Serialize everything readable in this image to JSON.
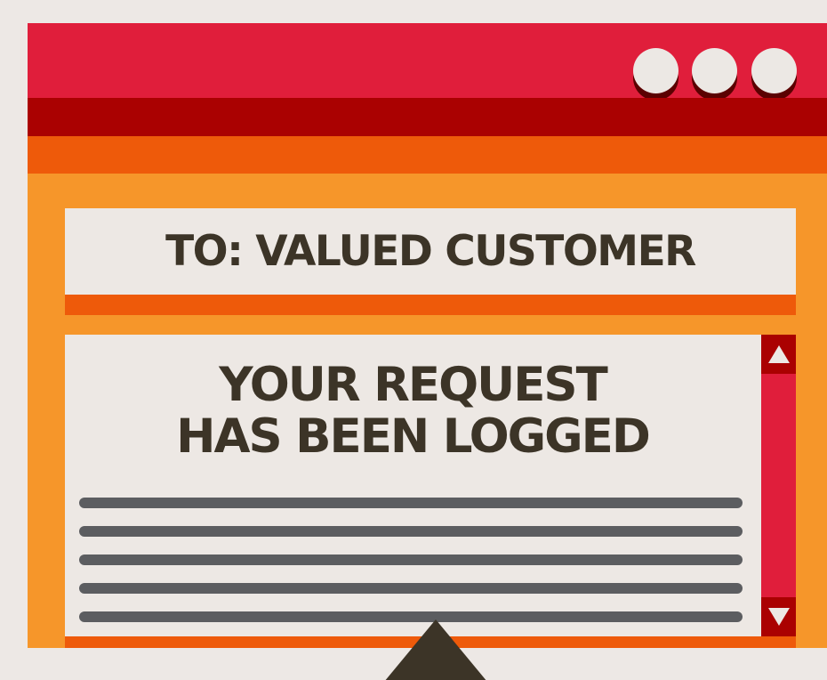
{
  "window": {
    "controls": [
      {
        "icon": "circle-icon"
      },
      {
        "icon": "circle-icon"
      },
      {
        "icon": "circle-icon"
      }
    ]
  },
  "recipient": {
    "text": "TO: VALUED CUSTOMER"
  },
  "message": {
    "headline_line1": "YOUR REQUEST",
    "headline_line2": "HAS BEEN LOGGED"
  },
  "scrollbar": {
    "up_icon": "triangle-up-icon",
    "down_icon": "triangle-down-icon"
  },
  "pointer": {
    "icon": "cursor-triangle-icon"
  },
  "colors": {
    "background": "#ede8e5",
    "window": "#f6962a",
    "title_bar": "#e01e3b",
    "title_bar_shadow": "#aa0101",
    "accent_orange": "#ee5a0a",
    "panel": "#ede8e4",
    "text_dark": "#3c3427",
    "text_lines": "#5c5d60"
  }
}
